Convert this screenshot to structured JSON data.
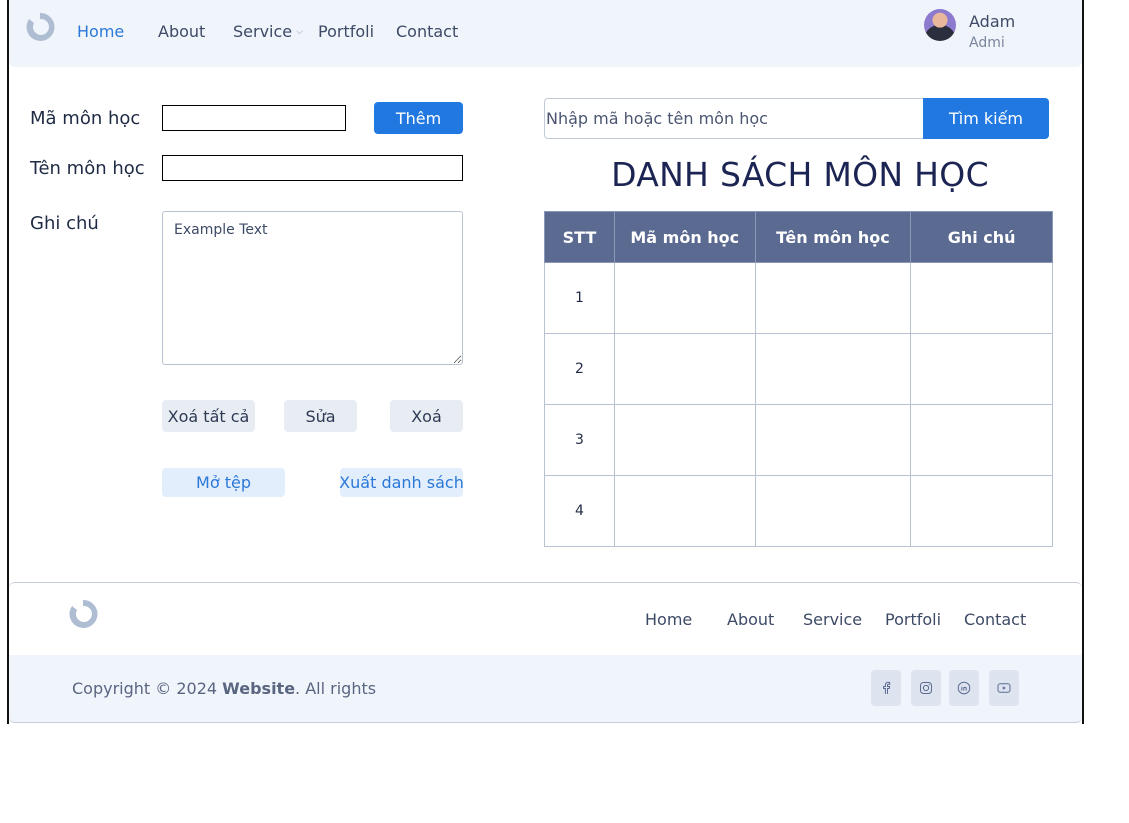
{
  "header": {
    "logo_icon": "ring-logo",
    "nav": [
      {
        "label": "Home",
        "active": true
      },
      {
        "label": "About",
        "active": false
      },
      {
        "label": "Service",
        "active": false,
        "has_dropdown": true
      },
      {
        "label": "Portfoli",
        "active": false
      },
      {
        "label": "Contact",
        "active": false
      }
    ],
    "user": {
      "name": "Adam",
      "role": "Admi"
    }
  },
  "form": {
    "code_label": "Mã môn học",
    "code_value": "",
    "name_label": "Tên môn học",
    "name_value": "",
    "note_label": "Ghi chú",
    "note_value": "Example Text",
    "add_button": "Thêm",
    "clear_all_button": "Xoá tất cả",
    "edit_button": "Sửa",
    "delete_button": "Xoá",
    "open_file_button": "Mở tệp",
    "export_button": "Xuất danh sách"
  },
  "search": {
    "placeholder": "Nhập mã hoặc tên môn học",
    "button": "Tìm kiếm"
  },
  "list": {
    "title": "DANH SÁCH MÔN HỌC",
    "columns": [
      "STT",
      "Mã môn học",
      "Tên môn học",
      "Ghi chú"
    ],
    "rows": [
      [
        "1",
        "",
        "",
        ""
      ],
      [
        "2",
        "",
        "",
        ""
      ],
      [
        "3",
        "",
        "",
        ""
      ],
      [
        "4",
        "",
        "",
        ""
      ]
    ]
  },
  "footer": {
    "nav": [
      "Home",
      "About",
      "Service",
      "Portfoli",
      "Contact"
    ],
    "copyright_prefix": "Copyright © 2024 ",
    "copyright_site": "Website",
    "copyright_suffix": ". All rights",
    "social_icons": [
      "facebook-icon",
      "instagram-icon",
      "linkedin-icon",
      "youtube-icon"
    ]
  },
  "colors": {
    "primary": "#2078e0",
    "header_bg": "#f0f5fc",
    "table_header_bg": "#5b6a91",
    "title": "#1b2452"
  }
}
